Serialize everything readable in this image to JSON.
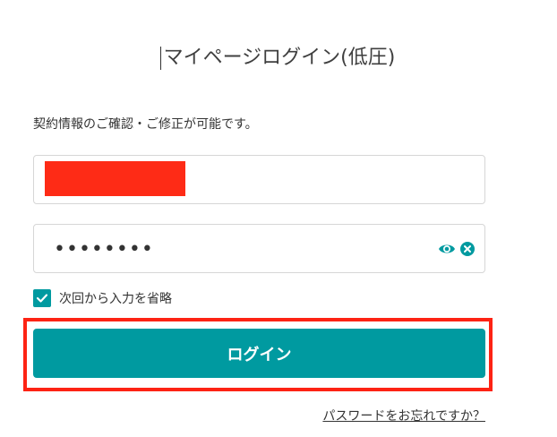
{
  "title": "マイページログイン(低圧)",
  "description": "契約情報のご確認・ご修正が可能です。",
  "fields": {
    "password_value": "••••••••"
  },
  "icons": {
    "show_password": "eye-icon",
    "clear_password": "clear-icon",
    "checkbox_check": "checkmark-icon"
  },
  "remember": {
    "label": "次回から入力を省略",
    "checked": true
  },
  "login_button": {
    "label": "ログイン"
  },
  "forgot_link": {
    "label": "パスワードをお忘れですか？"
  },
  "colors": {
    "accent": "#009aa0",
    "redaction": "#fe2b16",
    "highlight": "#fd2314",
    "border": "#d6d6d6"
  }
}
